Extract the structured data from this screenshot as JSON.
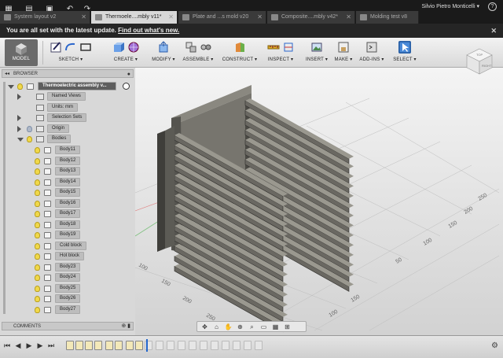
{
  "tabs": [
    {
      "label": "System layout v2",
      "active": false
    },
    {
      "label": "Thermoele....mbly v11*",
      "active": true
    },
    {
      "label": "Plate and ...s mold v20",
      "active": false
    },
    {
      "label": "Composite....mbly v42*",
      "active": false
    },
    {
      "label": "Molding test v8",
      "active": false
    }
  ],
  "user": {
    "name": "Silvio Pietro Monticelli"
  },
  "banner": {
    "text": "You are all set with the latest update.",
    "link": "Find out what's new."
  },
  "toolbar": {
    "workspace": "MODEL",
    "groups": [
      "SKETCH",
      "CREATE",
      "MODIFY",
      "ASSEMBLE",
      "CONSTRUCT",
      "INSPECT",
      "INSERT",
      "MAKE",
      "ADD-INS",
      "SELECT"
    ]
  },
  "viewcube": {
    "face": "RIGHT",
    "top": "TOP"
  },
  "browser": {
    "title": "BROWSER",
    "root": "Thermoelectric assembly v...",
    "items": [
      {
        "label": "Named Views"
      },
      {
        "label": "Units: mm"
      },
      {
        "label": "Selection Sets"
      },
      {
        "label": "Origin"
      },
      {
        "label": "Bodies"
      }
    ],
    "bodies": [
      "Body11",
      "Body12",
      "Body13",
      "Body14",
      "Body15",
      "Body16",
      "Body17",
      "Body18",
      "Body19",
      "Cold block",
      "Hot block",
      "Body23",
      "Body24",
      "Body25",
      "Body26",
      "Body27"
    ]
  },
  "comments": {
    "label": "COMMENTS"
  },
  "grid_labels": {
    "right": [
      "250",
      "200",
      "150",
      "100",
      "50"
    ],
    "bottom": [
      "150",
      "100",
      "50"
    ],
    "left": [
      "50",
      "100",
      "150",
      "200",
      "250"
    ]
  },
  "colors": {
    "accent": "#2266cc",
    "fin": "#6a6862",
    "fin_dark": "#3f3e3a",
    "banner": "#252525"
  },
  "icons": {
    "help": "?",
    "settings": "gear"
  }
}
